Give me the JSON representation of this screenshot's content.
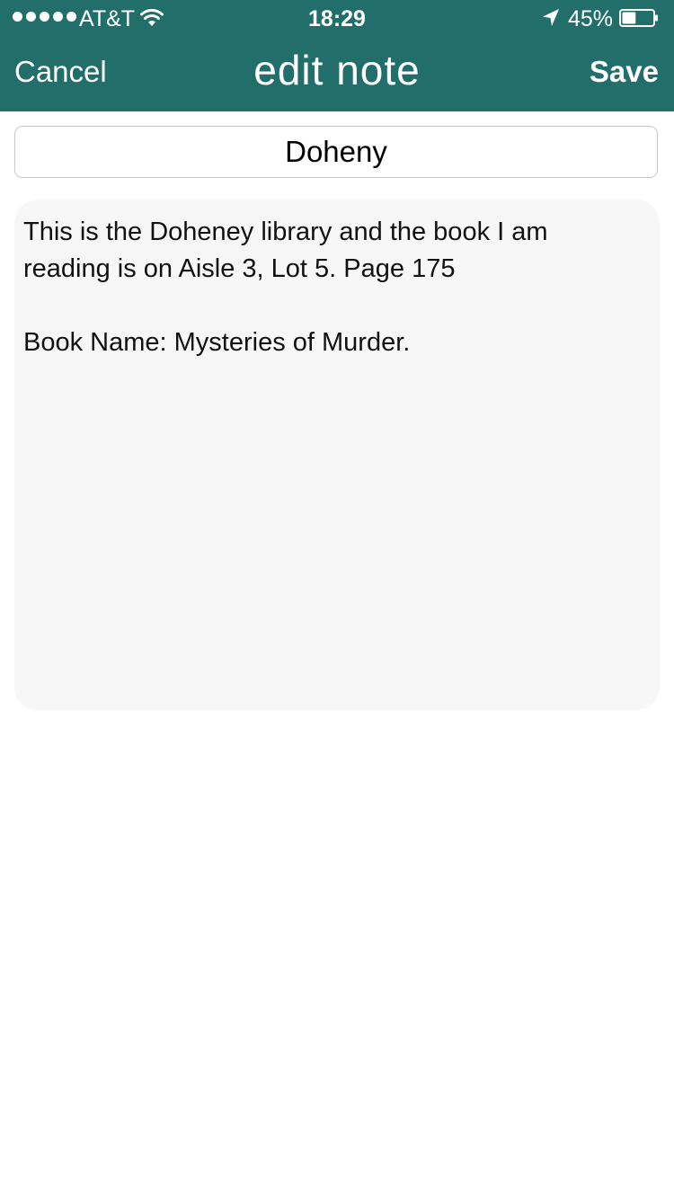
{
  "status_bar": {
    "carrier": "AT&T",
    "signal_bars": 5,
    "time": "18:29",
    "battery_percent": "45%",
    "battery_level": 0.45
  },
  "nav": {
    "cancel_label": "Cancel",
    "title": "edit note",
    "save_label": "Save"
  },
  "note": {
    "title_value": "Doheny",
    "body_lines": [
      "This is the Doheney library and the book I am",
      "reading is on Aisle 3, Lot 5. Page 175",
      "",
      "Book Name: Mysteries of Murder."
    ]
  },
  "colors": {
    "header_bg": "#226e6a",
    "body_bg": "#f7f7f7"
  }
}
